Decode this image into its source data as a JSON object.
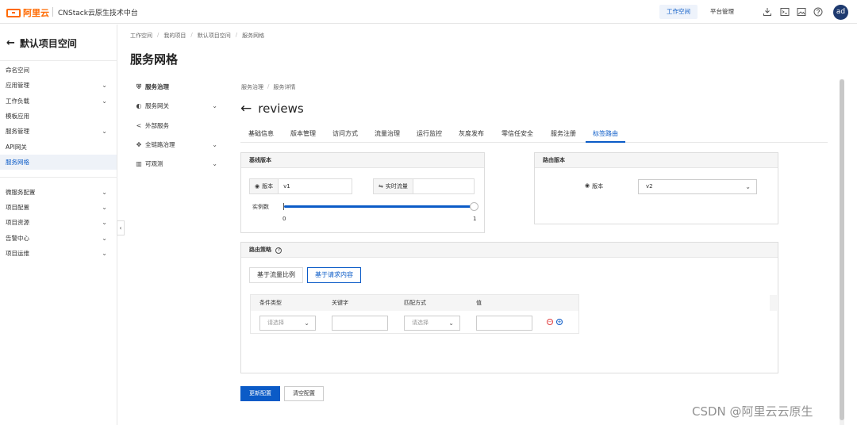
{
  "topbar": {
    "logo_text": "阿里云",
    "product": "CNStack云原生技术中台",
    "tabs": [
      "工作空间",
      "平台管理"
    ],
    "icons": [
      "download-icon",
      "terminal-icon",
      "image-icon",
      "help-icon"
    ],
    "avatar": "ad"
  },
  "sidebar": {
    "back_title": "默认项目空间",
    "items": [
      {
        "label": "命名空间",
        "chevron": false
      },
      {
        "label": "应用管理",
        "chevron": true
      },
      {
        "label": "工作负载",
        "chevron": true
      },
      {
        "label": "模板应用",
        "chevron": false
      },
      {
        "label": "服务管理",
        "chevron": true
      },
      {
        "label": "API网关",
        "chevron": false
      },
      {
        "label": "服务网格",
        "chevron": false,
        "active": true
      },
      {
        "label": "微服务配置",
        "chevron": true
      },
      {
        "label": "项目配置",
        "chevron": true
      },
      {
        "label": "项目资源",
        "chevron": true
      },
      {
        "label": "告警中心",
        "chevron": true
      },
      {
        "label": "项目运维",
        "chevron": true
      }
    ]
  },
  "header": {
    "breadcrumb": [
      "工作空间",
      "我的项目",
      "默认项目空间",
      "服务网格"
    ],
    "title": "服务网格"
  },
  "subnav": [
    {
      "label": "服务治理",
      "icon": "shield-icon",
      "chevron": false,
      "bold": true
    },
    {
      "label": "服务网关",
      "icon": "gateway-icon",
      "chevron": true
    },
    {
      "label": "外部服务",
      "icon": "share-icon",
      "chevron": false
    },
    {
      "label": "全链路治理",
      "icon": "link-icon",
      "chevron": true
    },
    {
      "label": "可观测",
      "icon": "chart-icon",
      "chevron": true
    }
  ],
  "content": {
    "breadcrumb": [
      "服务治理",
      "服务详情"
    ],
    "title": "reviews",
    "tabs": [
      "基础信息",
      "版本管理",
      "访问方式",
      "流量治理",
      "运行监控",
      "灰度发布",
      "零信任安全",
      "服务注册",
      "标签路由"
    ],
    "active_tab": "标签路由"
  },
  "baseline": {
    "title": "基线版本",
    "version_label": "版本",
    "version_value": "v1",
    "traffic_label": "实时流量",
    "traffic_value": "",
    "instances_label": "实例数",
    "slider_min": "0",
    "slider_max": "1",
    "slider_value": 1
  },
  "route_version": {
    "title": "路由版本",
    "version_label": "版本",
    "selected": "v2"
  },
  "strategy": {
    "title": "路由策略",
    "modes": [
      "基于流量比例",
      "基于请求内容"
    ],
    "active_mode": "基于请求内容",
    "columns": [
      "条件类型",
      "关键字",
      "匹配方式",
      "值"
    ],
    "row": {
      "condition_placeholder": "请选择",
      "match_placeholder": "请选择"
    }
  },
  "actions": {
    "update": "更新配置",
    "clear": "清空配置"
  },
  "watermark": "CSDN @阿里云云原生",
  "colors": {
    "accent": "#0b5bc7",
    "brand": "#ff6a00"
  }
}
